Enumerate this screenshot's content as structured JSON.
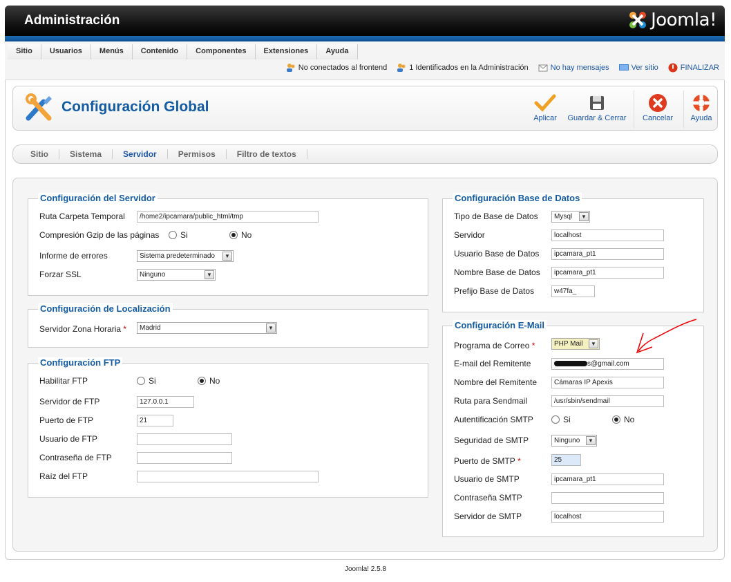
{
  "header": {
    "title": "Administración",
    "logo_text": "Joomla!"
  },
  "menu": [
    "Sitio",
    "Usuarios",
    "Menús",
    "Contenido",
    "Componentes",
    "Extensiones",
    "Ayuda"
  ],
  "status": {
    "frontend": "No conectados al frontend",
    "admin": "1 Identificados en la Administración",
    "messages": "No hay mensajes",
    "view_site": "Ver sitio",
    "logout": "FINALIZAR"
  },
  "page_title": "Configuración Global",
  "toolbar": {
    "apply": "Aplicar",
    "save_close": "Guardar & Cerrar",
    "cancel": "Cancelar",
    "help": "Ayuda"
  },
  "tabs": [
    "Sitio",
    "Sistema",
    "Servidor",
    "Permisos",
    "Filtro de textos"
  ],
  "server": {
    "legend": "Configuración del Servidor",
    "tmp_label": "Ruta Carpeta Temporal",
    "tmp_value": "/home2/ipcamara/public_html/tmp",
    "gzip_label": "Compresión Gzip de las páginas",
    "yes": "Si",
    "no": "No",
    "errors_label": "Informe de errores",
    "errors_value": "Sistema predeterminado",
    "ssl_label": "Forzar SSL",
    "ssl_value": "Ninguno"
  },
  "locale": {
    "legend": "Configuración de Localización",
    "tz_label": "Servidor Zona Horaria",
    "tz_value": "Madrid"
  },
  "ftp": {
    "legend": "Configuración FTP",
    "enable_label": "Habilitar FTP",
    "yes": "Si",
    "no": "No",
    "host_label": "Servidor de FTP",
    "host_value": "127.0.0.1",
    "port_label": "Puerto de FTP",
    "port_value": "21",
    "user_label": "Usuario de FTP",
    "pass_label": "Contraseña de FTP",
    "root_label": "Raíz del FTP"
  },
  "db": {
    "legend": "Configuración Base de Datos",
    "type_label": "Tipo de Base de Datos",
    "type_value": "Mysql",
    "host_label": "Servidor",
    "host_value": "localhost",
    "user_label": "Usuario Base de Datos",
    "user_value": "ipcamara_pt1",
    "name_label": "Nombre Base de Datos",
    "name_value": "ipcamara_pt1",
    "prefix_label": "Prefijo Base de Datos",
    "prefix_value": "w47fa_"
  },
  "mail": {
    "legend": "Configuración E-Mail",
    "mailer_label": "Programa de Correo",
    "mailer_value": "PHP Mail",
    "from_label": "E-mail del Remitente",
    "from_value": "s@gmail.com",
    "fromname_label": "Nombre del Remitente",
    "fromname_value": "Cámaras IP Apexis",
    "sendmail_label": "Ruta para Sendmail",
    "sendmail_value": "/usr/sbin/sendmail",
    "auth_label": "Autentificación SMTP",
    "yes": "Si",
    "no": "No",
    "secure_label": "Seguridad de SMTP",
    "secure_value": "Ninguno",
    "port_label": "Puerto de SMTP",
    "port_value": "25",
    "user_label": "Usuario de SMTP",
    "user_value": "ipcamara_pt1",
    "pass_label": "Contraseña SMTP",
    "host_label": "Servidor de SMTP",
    "host_value": "localhost"
  },
  "footer": "Joomla! 2.5.8"
}
